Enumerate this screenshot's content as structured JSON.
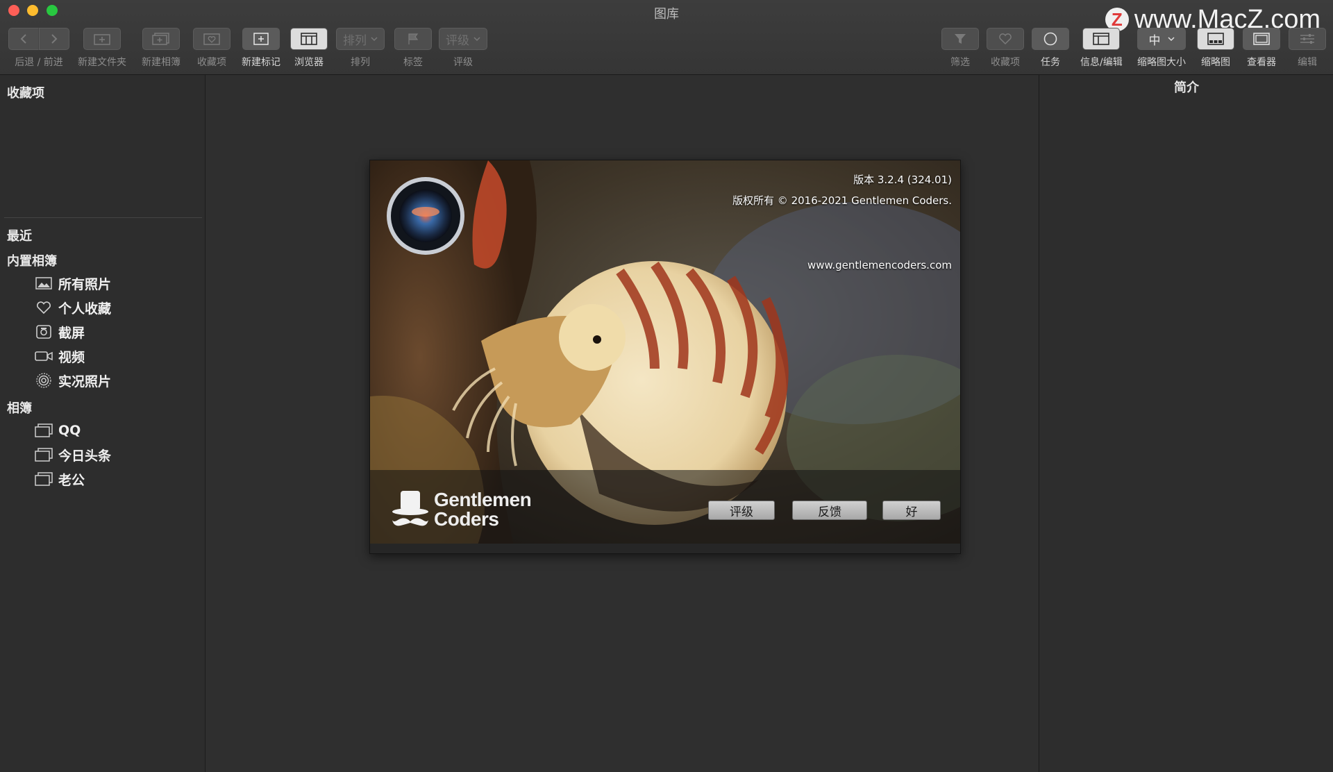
{
  "window": {
    "title": "图库"
  },
  "watermark": {
    "logo_letter": "Z",
    "text": "www.MacZ.com"
  },
  "toolbar": {
    "back_forward_label": "后退 / 前进",
    "new_folder_label": "新建文件夹",
    "new_album_label": "新建相簿",
    "favorites_label": "收藏项",
    "new_marker_label": "新建标记",
    "browser_label": "浏览器",
    "sort_button": "排列",
    "sort_label": "排列",
    "tag_label": "标签",
    "rating_button": "评级",
    "rating_label": "评级",
    "filter_label": "筛选",
    "favorites_right_label": "收藏项",
    "tasks_label": "任务",
    "info_edit_label": "信息/编辑",
    "thumb_size_button": "中",
    "thumb_size_label": "缩略图大小",
    "thumbnails_label": "缩略图",
    "viewer_label": "查看器",
    "edit_label": "编辑"
  },
  "sidebar": {
    "favorites_title": "收藏项",
    "recent_title": "最近",
    "builtin_title": "内置相簿",
    "builtin_items": [
      {
        "label": "所有照片",
        "icon": "photo-icon"
      },
      {
        "label": "个人收藏",
        "icon": "heart-icon"
      },
      {
        "label": "截屏",
        "icon": "camera-icon"
      },
      {
        "label": "视频",
        "icon": "video-icon"
      },
      {
        "label": "实况照片",
        "icon": "live-photo-icon"
      }
    ],
    "albums_title": "相簿",
    "albums": [
      {
        "label": "QQ",
        "icon": "album-icon"
      },
      {
        "label": "今日头条",
        "icon": "album-icon"
      },
      {
        "label": "老公",
        "icon": "album-icon"
      }
    ]
  },
  "splash": {
    "version": "版本 3.2.4 (324.01)",
    "copyright": "版权所有 © 2016-2021 Gentlemen Coders.",
    "website": "www.gentlemencoders.com",
    "brand_line1": "Gentlemen",
    "brand_line2": "Coders",
    "rate_button": "评级",
    "feedback_button": "反馈",
    "ok_button": "好"
  },
  "right_panel": {
    "title": "简介"
  }
}
